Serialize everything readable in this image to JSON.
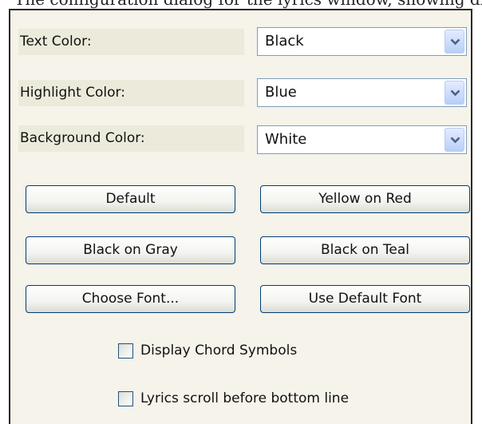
{
  "top_cut_text": "The configuration dialog for the lyrics window, showing display category options",
  "fields": [
    {
      "label": "Text Color:",
      "value": "Black"
    },
    {
      "label": "Highlight Color:",
      "value": "Blue"
    },
    {
      "label": "Background Color:",
      "value": "White"
    }
  ],
  "buttons": {
    "default": "Default",
    "yellow_on_red": "Yellow on Red",
    "black_on_gray": "Black on Gray",
    "black_on_teal": "Black on Teal",
    "choose_font": "Choose Font...",
    "use_default_font": "Use Default Font"
  },
  "checkboxes": [
    {
      "label": "Display Chord Symbols",
      "checked": false
    },
    {
      "label": "Lyrics scroll before bottom line",
      "checked": false
    }
  ],
  "colors": {
    "panel_bg": "#f5f3ea",
    "label_bg": "#ecebdb",
    "accent": "#3c6ef0"
  },
  "icons": {
    "dropdown": "chevron-down-icon"
  }
}
